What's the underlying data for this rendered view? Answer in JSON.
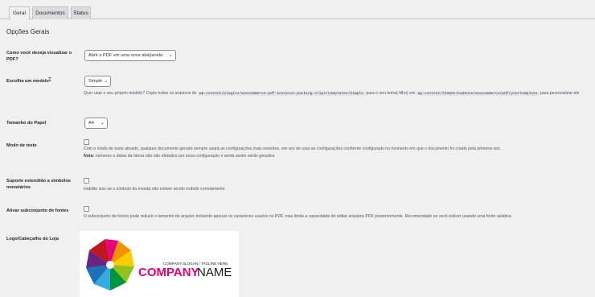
{
  "tabs": [
    {
      "label": "Geral",
      "active": true
    },
    {
      "label": "Documentos",
      "active": false
    },
    {
      "label": "Status",
      "active": false
    }
  ],
  "section_title": "Opções Gerais",
  "view_pdf": {
    "label": "Como você deseja visualizar o PDF?",
    "selected": "Abrir o PDF em uma nova aba/janela"
  },
  "template": {
    "label": "Escolha um modelo",
    "selected": "Simple",
    "desc_prefix": "Quer usar o seu próprio modelo? Copie todos os arquivos de",
    "code1": "wp-content/plugins/woocommerce-pdf-invoices-packing-slips/templates/Simple",
    "desc_mid": "para o seu tema(-filho) em",
    "code2": "wp-content/themes/kadence/woocommerce/pdf/yourtemplate",
    "desc_suffix": "para personalizar ele"
  },
  "paper": {
    "label": "Tamanho do Papel",
    "selected": "A4"
  },
  "test_mode": {
    "label": "Modo de teste",
    "checked": false,
    "desc": "Com o modo de teste ativado, qualquer documento gerado sempre usará as configurações mais recentes, em vez de usar as configurações conforme configurado no momento em que o documento foi criado pela primeira vez.",
    "note_label": "Nota:",
    "note": "números e datas da fatura não são afetados por essa configuração e ainda assim serão gerados."
  },
  "currency": {
    "label": "Suporte estendido a símbolos monetários",
    "checked": false,
    "desc": "Habilite isso se o símbolo da moeda não estiver sendo exibido corretamente"
  },
  "font_subset": {
    "label": "Ativar subconjunto de fontes",
    "checked": false,
    "desc": "O subconjunto de fontes pode reduzir o tamanho do arquivo incluindo apenas os caracteres usados no PDF, mas limita a capacidade de editar arquivos PDF posteriormente. Recomendado se você estiver usando uma fonte asiática."
  },
  "logo": {
    "label": "Logo/Cabeçalho do Loja",
    "slogan": "COMPANY SLOGAN / TAGLINE HERE",
    "company": "COMPANY",
    "name": "NAME",
    "company_color": "#e4007c",
    "name_color": "#1d1d1b"
  },
  "icons": {
    "select_chevron": "chevron-down-icon",
    "logo_mark": "pinwheel-logo-icon",
    "cursor": "text-cursor-icon"
  }
}
